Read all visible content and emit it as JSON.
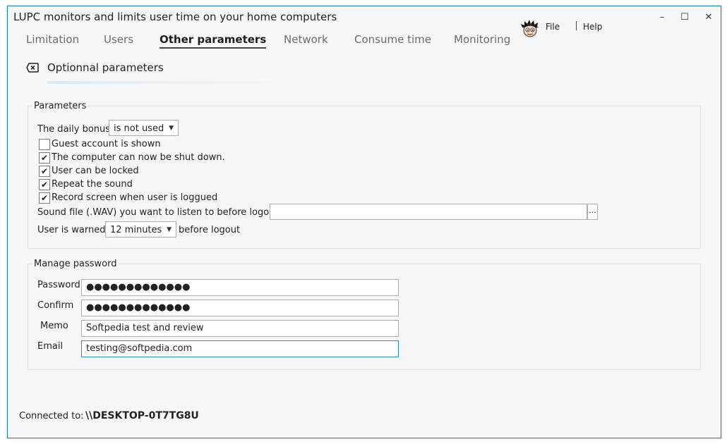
{
  "window": {
    "title": "LUPC monitors and limits user time on your home computers",
    "controls": {
      "minimize": "–",
      "maximize": "☐",
      "close": "✕"
    }
  },
  "tabs": [
    {
      "label": "Limitation",
      "active": false
    },
    {
      "label": "Users",
      "active": false
    },
    {
      "label": "Other parameters",
      "active": true
    },
    {
      "label": "Network",
      "active": false
    },
    {
      "label": "Consume time",
      "active": false
    },
    {
      "label": "Monitoring",
      "active": false
    }
  ],
  "menu": {
    "avatar_icon": "cartoon-avatar-icon",
    "file": "File",
    "help": "Help"
  },
  "section": {
    "icon": "close-box-icon",
    "title": "Optionnal parameters"
  },
  "parameters": {
    "legend": "Parameters",
    "daily_bonus_label": "The daily bonus",
    "daily_bonus_value": "is not used",
    "checkboxes": [
      {
        "label": "Guest account is shown",
        "checked": false
      },
      {
        "label": "The computer can now be shut down.",
        "checked": true
      },
      {
        "label": "User can be locked",
        "checked": true
      },
      {
        "label": "Repeat the sound",
        "checked": true
      },
      {
        "label": "Record screen when user is loggued",
        "checked": true
      }
    ],
    "sound_file_label": "Sound file  (.WAV) you want to listen to before logout",
    "sound_file_value": "",
    "browse_label": "...",
    "warned_label": "User is warned",
    "warned_value": "12 minutes",
    "warned_suffix": "before logout"
  },
  "password": {
    "legend": "Manage password",
    "fields": [
      {
        "label": "Password",
        "value": "●●●●●●●●●●●●●"
      },
      {
        "label": "Confirm",
        "value": "●●●●●●●●●●●●●"
      },
      {
        "label": "Memo",
        "value": "Softpedia test and review"
      },
      {
        "label": "Email",
        "value": "testing@softpedia.com"
      }
    ]
  },
  "status": {
    "label": "Connected to:",
    "value": "\\\\DESKTOP-0T7TG8U"
  },
  "colors": {
    "accent": "#2a8fbd",
    "border": "#1f7fa8",
    "background": "#f6f7f8"
  }
}
